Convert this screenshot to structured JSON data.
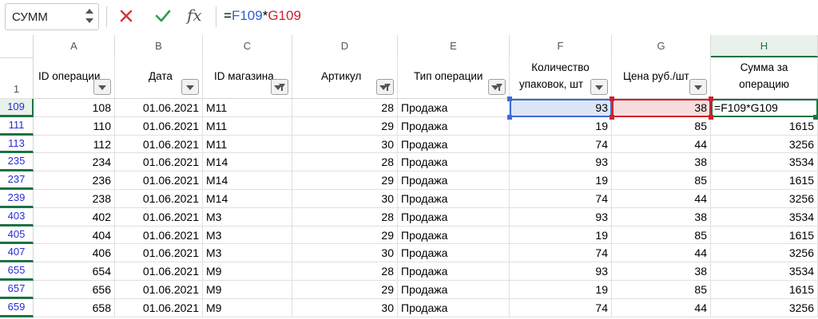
{
  "name_box": "СУММ",
  "formula_bar": {
    "prefix": "=",
    "ref1": "F109",
    "op": "*",
    "ref2": "G109"
  },
  "columns": [
    "A",
    "B",
    "C",
    "D",
    "E",
    "F",
    "G",
    "H"
  ],
  "headers": {
    "A": "ID операции",
    "B": "Дата",
    "C": "ID магазина",
    "D": "Артикул",
    "E": "Тип операции",
    "F1": "Количество",
    "F2": "упаковок, шт",
    "G": "Цена руб./шт",
    "H1": "Сумма за",
    "H2": "операцию"
  },
  "header_row_number": "1",
  "rows": [
    {
      "rn": "109",
      "a": "108",
      "b": "01.06.2021",
      "c": "М11",
      "d": "28",
      "e": "Продажа",
      "f": "93",
      "g": "38",
      "h": ""
    },
    {
      "rn": "111",
      "a": "110",
      "b": "01.06.2021",
      "c": "М11",
      "d": "29",
      "e": "Продажа",
      "f": "19",
      "g": "85",
      "h": "1615"
    },
    {
      "rn": "113",
      "a": "112",
      "b": "01.06.2021",
      "c": "М11",
      "d": "30",
      "e": "Продажа",
      "f": "74",
      "g": "44",
      "h": "3256"
    },
    {
      "rn": "235",
      "a": "234",
      "b": "01.06.2021",
      "c": "М14",
      "d": "28",
      "e": "Продажа",
      "f": "93",
      "g": "38",
      "h": "3534"
    },
    {
      "rn": "237",
      "a": "236",
      "b": "01.06.2021",
      "c": "М14",
      "d": "29",
      "e": "Продажа",
      "f": "19",
      "g": "85",
      "h": "1615"
    },
    {
      "rn": "239",
      "a": "238",
      "b": "01.06.2021",
      "c": "М14",
      "d": "30",
      "e": "Продажа",
      "f": "74",
      "g": "44",
      "h": "3256"
    },
    {
      "rn": "403",
      "a": "402",
      "b": "01.06.2021",
      "c": "М3",
      "d": "28",
      "e": "Продажа",
      "f": "93",
      "g": "38",
      "h": "3534"
    },
    {
      "rn": "405",
      "a": "404",
      "b": "01.06.2021",
      "c": "М3",
      "d": "29",
      "e": "Продажа",
      "f": "19",
      "g": "85",
      "h": "1615"
    },
    {
      "rn": "407",
      "a": "406",
      "b": "01.06.2021",
      "c": "М3",
      "d": "30",
      "e": "Продажа",
      "f": "74",
      "g": "44",
      "h": "3256"
    },
    {
      "rn": "655",
      "a": "654",
      "b": "01.06.2021",
      "c": "М9",
      "d": "28",
      "e": "Продажа",
      "f": "93",
      "g": "38",
      "h": "3534"
    },
    {
      "rn": "657",
      "a": "656",
      "b": "01.06.2021",
      "c": "М9",
      "d": "29",
      "e": "Продажа",
      "f": "19",
      "g": "85",
      "h": "1615"
    },
    {
      "rn": "659",
      "a": "658",
      "b": "01.06.2021",
      "c": "М9",
      "d": "30",
      "e": "Продажа",
      "f": "74",
      "g": "44",
      "h": "3256"
    }
  ],
  "editing_cell": {
    "prefix": "=",
    "ref1": "F109",
    "op": "*",
    "ref2": "G109"
  },
  "colors": {
    "accent_green": "#1e7145",
    "ref_blue": "#3d6ad6",
    "ref_red": "#d0202c",
    "row_link": "#2a2ad8"
  },
  "icons": [
    "cancel-icon",
    "enter-check-icon",
    "fx-icon",
    "filter-dropdown-icon",
    "filter-funnel-icon"
  ]
}
